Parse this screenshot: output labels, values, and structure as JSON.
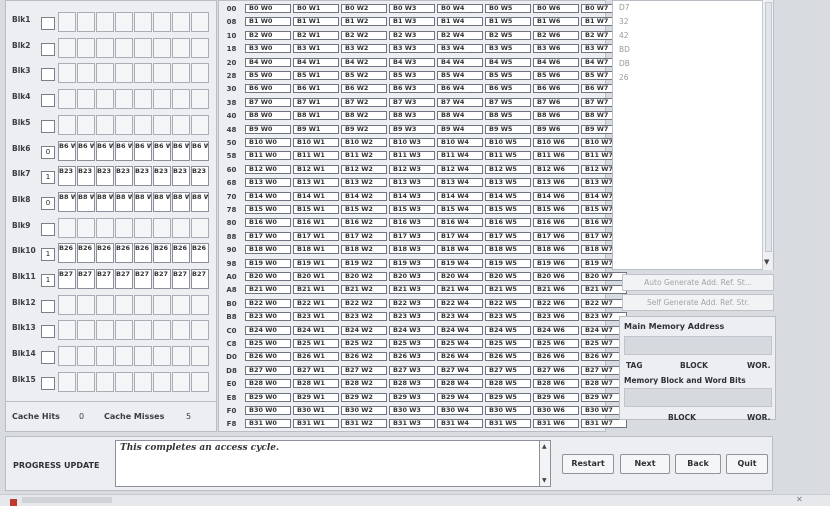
{
  "cache": {
    "blocks": [
      {
        "label": "Blk1"
      },
      {
        "label": "Blk2"
      },
      {
        "label": "Blk3"
      },
      {
        "label": "Blk4"
      },
      {
        "label": "Blk5"
      },
      {
        "label": "Blk6",
        "tag": "0",
        "words": [
          "B6 W0",
          "B6 W1",
          "B6 W2",
          "B6 W3",
          "B6 W4",
          "B6 W5",
          "B6 W6",
          "B6 W7"
        ]
      },
      {
        "label": "Blk7",
        "tag": "1",
        "words": [
          "B23 W0",
          "B23 W1",
          "B23 W2",
          "B23 W3",
          "B23 W4",
          "B23 W5",
          "B23 W6",
          "B23 W7"
        ]
      },
      {
        "label": "Blk8",
        "tag": "0",
        "words": [
          "B8 W0",
          "B8 W1",
          "B8 W2",
          "B8 W3",
          "B8 W4",
          "B8 W5",
          "B8 W6",
          "B8 W7"
        ]
      },
      {
        "label": "Blk9"
      },
      {
        "label": "Blk10",
        "tag": "1",
        "words": [
          "B26 W0",
          "B26 W1",
          "B26 W2",
          "B26 W3",
          "B26 W4",
          "B26 W5",
          "B26 W6",
          "B26 W7"
        ]
      },
      {
        "label": "Blk11",
        "tag": "1",
        "words": [
          "B27 W0",
          "B27 W1",
          "B27 W2",
          "B27 W3",
          "B27 W4",
          "B27 W5",
          "B27 W6",
          "B27 W7"
        ]
      },
      {
        "label": "Blk12"
      },
      {
        "label": "Blk13"
      },
      {
        "label": "Blk14"
      },
      {
        "label": "Blk15"
      }
    ],
    "hits_label": "Cache Hits",
    "hits_value": "0",
    "misses_label": "Cache Misses",
    "misses_value": "5"
  },
  "memory": {
    "rows": [
      {
        "addr": "00",
        "block": "B0"
      },
      {
        "addr": "08",
        "block": "B1"
      },
      {
        "addr": "10",
        "block": "B2"
      },
      {
        "addr": "18",
        "block": "B3"
      },
      {
        "addr": "20",
        "block": "B4"
      },
      {
        "addr": "28",
        "block": "B5"
      },
      {
        "addr": "30",
        "block": "B6"
      },
      {
        "addr": "38",
        "block": "B7"
      },
      {
        "addr": "40",
        "block": "B8"
      },
      {
        "addr": "48",
        "block": "B9"
      },
      {
        "addr": "50",
        "block": "B10"
      },
      {
        "addr": "58",
        "block": "B11"
      },
      {
        "addr": "60",
        "block": "B12"
      },
      {
        "addr": "68",
        "block": "B13"
      },
      {
        "addr": "70",
        "block": "B14"
      },
      {
        "addr": "78",
        "block": "B15"
      },
      {
        "addr": "80",
        "block": "B16"
      },
      {
        "addr": "88",
        "block": "B17"
      },
      {
        "addr": "90",
        "block": "B18"
      },
      {
        "addr": "98",
        "block": "B19"
      },
      {
        "addr": "A0",
        "block": "B20"
      },
      {
        "addr": "A8",
        "block": "B21"
      },
      {
        "addr": "B0",
        "block": "B22"
      },
      {
        "addr": "B8",
        "block": "B23"
      },
      {
        "addr": "C0",
        "block": "B24"
      },
      {
        "addr": "C8",
        "block": "B25"
      },
      {
        "addr": "D0",
        "block": "B26"
      },
      {
        "addr": "D8",
        "block": "B27"
      },
      {
        "addr": "E0",
        "block": "B28"
      },
      {
        "addr": "E8",
        "block": "B29"
      },
      {
        "addr": "F0",
        "block": "B30"
      },
      {
        "addr": "F8",
        "block": "B31"
      }
    ],
    "words": [
      "W0",
      "W1",
      "W2",
      "W3",
      "W4",
      "W5",
      "W6",
      "W7"
    ]
  },
  "reference": {
    "items": [
      "D7",
      "32",
      "42",
      "BD",
      "DB",
      "26"
    ],
    "auto_generate_label": "Auto Generate Add. Ref. St...",
    "self_generate_label": "Self Generate Add. Ref. Str."
  },
  "main_memory_address": {
    "title": "Main Memory Address",
    "tag_label": "TAG",
    "block_label": "BLOCK",
    "word_label": "WOR."
  },
  "memory_block_word_bits": {
    "title": "Memory Block and Word Bits",
    "block_label": "BLOCK",
    "word_label": "WOR."
  },
  "progress": {
    "label": "PROGRESS UPDATE",
    "text": "This completes an access cycle."
  },
  "buttons": {
    "restart": "Restart",
    "next": "Next",
    "back": "Back",
    "quit": "Quit"
  }
}
